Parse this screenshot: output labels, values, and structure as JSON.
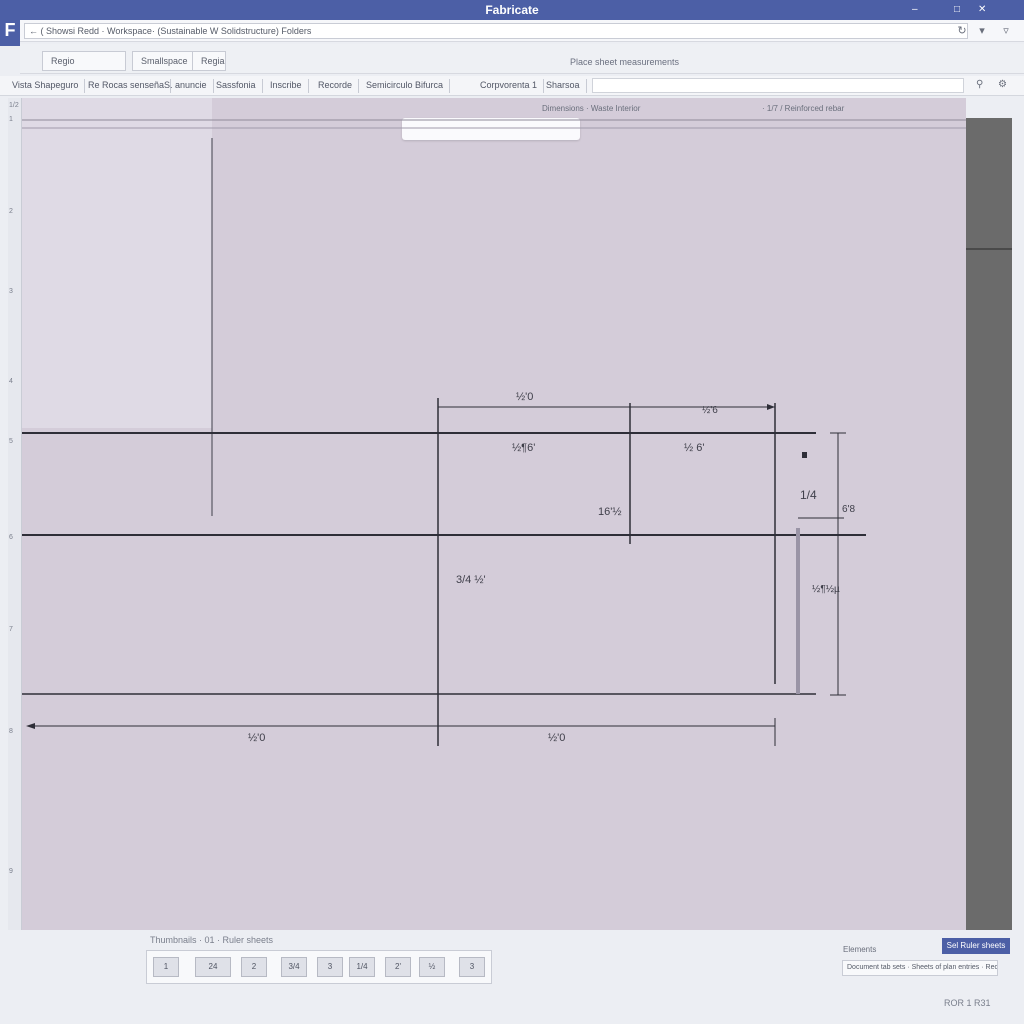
{
  "window": {
    "title": "Fabricate",
    "controls": [
      "–",
      "□",
      "✕"
    ],
    "logo": "F"
  },
  "pathbar": {
    "value": "← ( Showsi Redd · Workspace· (Sustainable W Solidstructure) Folders",
    "icons": [
      "refresh-icon",
      "filter-icon"
    ]
  },
  "toolbar1": {
    "buttons": [
      "Regio",
      "Smallspace",
      "Regia"
    ],
    "status": "Place sheet measurements"
  },
  "toolbar2": {
    "items": [
      "Vista Shapeguro",
      "Re Rocas senseña",
      "S. anuncie",
      "Sassfonia",
      "Inscribe",
      "Recorde",
      "Semicirculo Bifurca",
      "Corpvorenta 1",
      "Sharsoa"
    ],
    "icons": [
      "zoom-icon",
      "settings-icon"
    ]
  },
  "ruler": {
    "marks": [
      "1/2",
      "1",
      "2",
      "3",
      "4",
      "5",
      "6",
      "7",
      "8",
      "9"
    ]
  },
  "canvas": {
    "header_left": "Dimensions · Waste Interior",
    "header_right": "· 1/7 / Reinforced rebar",
    "dims": {
      "top_span": "½'0",
      "top_right": "½'6",
      "mid_left": "½¶6'",
      "mid_right": "½ 6'",
      "vert_left": "16'½",
      "vert_right": "1/4",
      "right_a": "6'8",
      "right_b": "½¶½µ",
      "diag": "3/4 ½'",
      "bottom_left": "½'0",
      "bottom_right": "½'0"
    }
  },
  "bottom": {
    "label": "Thumbnails  · 01 · Ruler sheets",
    "thumbs": [
      "1",
      "24",
      "2",
      "3/4",
      "3",
      "1/4",
      "2'",
      "½",
      "3"
    ],
    "apply_button": "Sel Ruler sheets",
    "hint_label": "Elements",
    "hint_value": "Document tab sets · Sheets of plan entries · Recorde",
    "corner": "ROR 1 R31"
  },
  "colors": {
    "accent": "#4c5fa6",
    "canvas": "#d4ccd9",
    "right_panel": "#6b6b6b"
  }
}
